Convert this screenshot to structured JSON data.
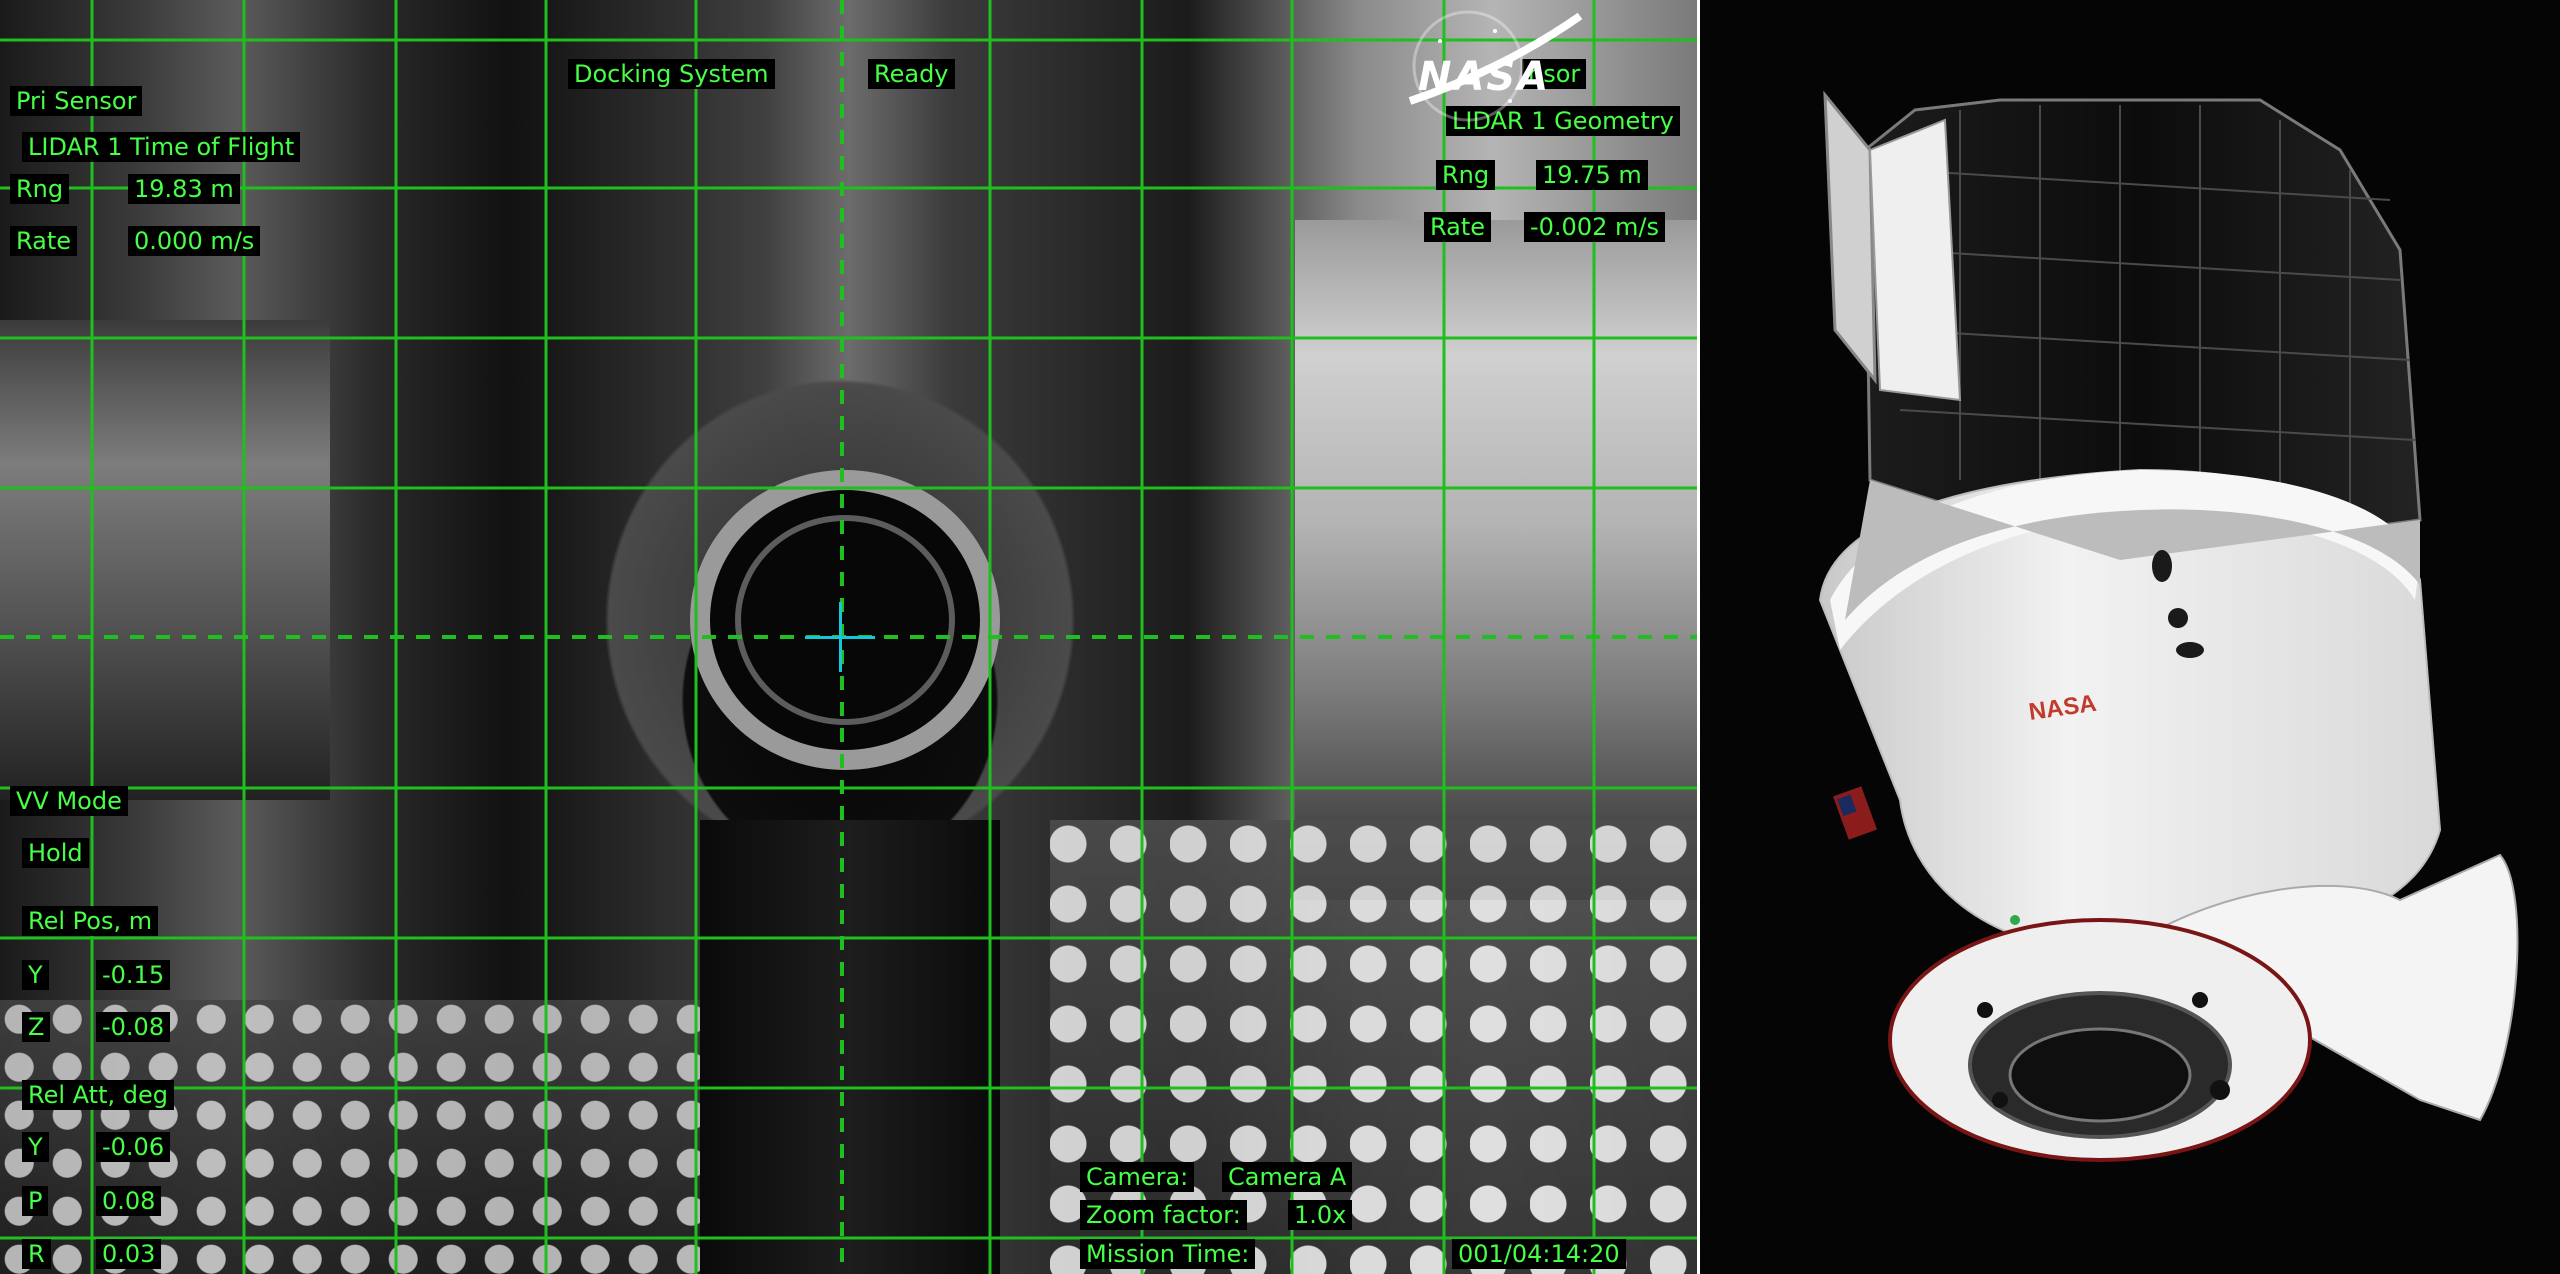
{
  "hud": {
    "docking_system_label": "Docking System",
    "docking_system_status": "Ready",
    "pri_sensor": {
      "label": "Pri Sensor",
      "source": "LIDAR 1 Time of Flight",
      "rng_label": "Rng",
      "rng_value": "19.83 m",
      "rate_label": "Rate",
      "rate_value": "0.000 m/s"
    },
    "sec_sensor": {
      "label_fragment": "nsor",
      "source": "LIDAR 1 Geometry",
      "rng_label": "Rng",
      "rng_value": "19.75 m",
      "rate_label": "Rate",
      "rate_value": "-0.002 m/s"
    },
    "vv_mode": {
      "label": "VV Mode",
      "value": "Hold"
    },
    "rel_pos": {
      "label": "Rel Pos, m",
      "y_label": "Y",
      "y_value": "-0.15",
      "z_label": "Z",
      "z_value": "-0.08"
    },
    "rel_att": {
      "label": "Rel Att, deg",
      "y_label": "Y",
      "y_value": "-0.06",
      "p_label": "P",
      "p_value": "0.08",
      "r_label": "R",
      "r_value": "0.03"
    },
    "camera": {
      "camera_label": "Camera:",
      "camera_value": "Camera A",
      "zoom_label": "Zoom factor:",
      "zoom_value": "1.0x",
      "mission_label": "Mission Time:",
      "mission_value": "001/04:14:20"
    }
  },
  "logo": {
    "text": "NASA"
  },
  "spacecraft": {
    "marking": "NASA"
  },
  "colors": {
    "hud_green": "#46ff46",
    "grid_green": "#1fbf1f",
    "crosshair": "#17c7d6",
    "background": "#000000"
  }
}
